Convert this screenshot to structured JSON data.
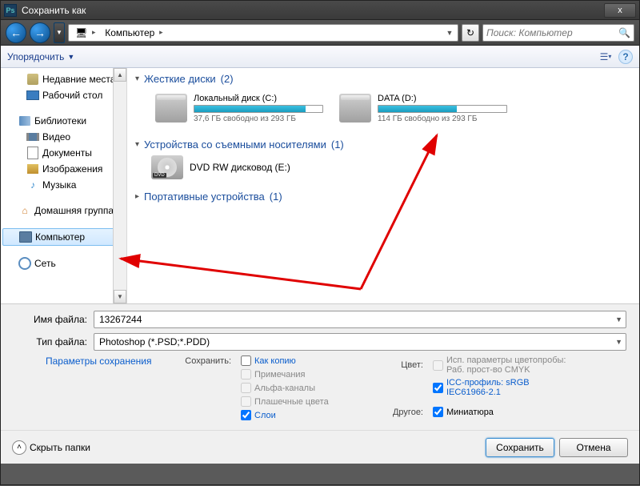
{
  "window": {
    "title": "Сохранить как"
  },
  "nav": {
    "computer_icon": "🖥",
    "breadcrumb": "Компьютер"
  },
  "search": {
    "placeholder": "Поиск: Компьютер"
  },
  "toolbar": {
    "organize": "Упорядочить"
  },
  "sidebar": {
    "recent": "Недавние места",
    "desktop": "Рабочий стол",
    "libraries": "Библиотеки",
    "video": "Видео",
    "documents": "Документы",
    "images": "Изображения",
    "music": "Музыка",
    "homegroup": "Домашняя группа",
    "computer": "Компьютер",
    "network": "Сеть"
  },
  "groups": {
    "hdd": {
      "label": "Жесткие диски",
      "count": "(2)"
    },
    "removable": {
      "label": "Устройства со съемными носителями",
      "count": "(1)"
    },
    "portable": {
      "label": "Портативные устройства",
      "count": "(1)"
    }
  },
  "drives": {
    "c": {
      "name": "Локальный диск (C:)",
      "stat": "37,6 ГБ свободно из 293 ГБ",
      "fill": 87
    },
    "d": {
      "name": "DATA (D:)",
      "stat": "114 ГБ свободно из 293 ГБ",
      "fill": 61
    },
    "dvd": {
      "name": "DVD RW дисковод (E:)"
    }
  },
  "fields": {
    "name_label": "Имя файла:",
    "name_value": "13267244",
    "type_label": "Тип файла:",
    "type_value": "Photoshop (*.PSD;*.PDD)"
  },
  "opts": {
    "save_params": "Параметры сохранения",
    "save_label": "Сохранить:",
    "as_copy": "Как копию",
    "notes": "Примечания",
    "alpha": "Альфа-каналы",
    "spot": "Плашечные цвета",
    "layers": "Слои",
    "color_label": "Цвет:",
    "cmyk": "Исп. параметры цветопробы: Раб. прост-во CMYK",
    "icc": "ICC-профиль: sRGB IEC61966-2.1",
    "other_label": "Другое:",
    "thumb": "Миниатюра"
  },
  "footer": {
    "hide": "Скрыть папки",
    "save": "Сохранить",
    "cancel": "Отмена"
  }
}
